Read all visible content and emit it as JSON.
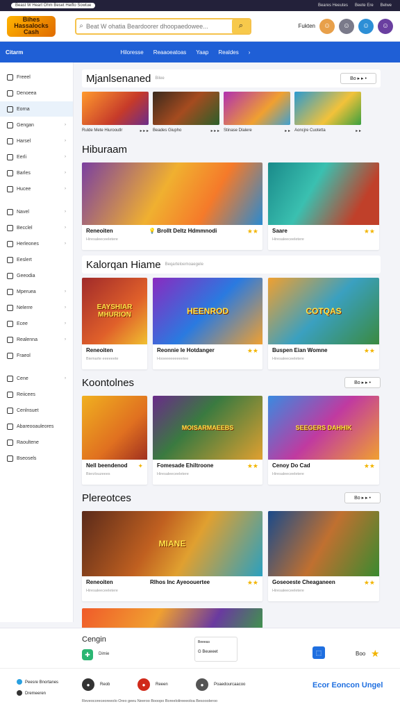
{
  "topbar": {
    "pill": "Beast W Heart Ohm Beset Heiflo Sowtue",
    "links": [
      "Beares Heeutes",
      "Beete Ere",
      "Belwe"
    ]
  },
  "header": {
    "logo": "Bihes Hassalocks Cash",
    "search_placeholder": "Beat W ohatia Beardoorer dhoopaedowee...",
    "right_label": "Fukten"
  },
  "nav": {
    "brand": "Citarm",
    "items": [
      "Hiloresse",
      "Reaaoeatoas",
      "Yaap",
      "Realdes",
      "›"
    ]
  },
  "sidebar": {
    "items": [
      {
        "label": "Freeel",
        "icon": "refresh-icon",
        "chev": ""
      },
      {
        "label": "Denoeea",
        "icon": "globe-icon",
        "chev": ""
      },
      {
        "label": "Eorna",
        "icon": "star-icon",
        "chev": "",
        "active": true
      },
      {
        "label": "Gengan",
        "icon": "controller-icon",
        "chev": "›"
      },
      {
        "label": "Harsel",
        "icon": "gift-icon",
        "chev": "›"
      },
      {
        "label": "Eerli",
        "icon": "trophy-icon",
        "chev": "›"
      },
      {
        "label": "Barles",
        "icon": "puzzle-icon",
        "chev": "›"
      },
      {
        "label": "Hucee",
        "icon": "chart-icon",
        "chev": "›"
      },
      {
        "label": "Navel",
        "icon": "sword-icon",
        "chev": "›"
      },
      {
        "label": "Becclel",
        "icon": "target-icon",
        "chev": "›"
      },
      {
        "label": "Herleones",
        "icon": "crown-icon",
        "chev": "›"
      },
      {
        "label": "Eeslert",
        "icon": "bolt-icon",
        "chev": ""
      },
      {
        "label": "Geeodia",
        "icon": "gem-icon",
        "chev": ""
      },
      {
        "label": "Mperuea",
        "icon": "music-icon",
        "chev": "›"
      },
      {
        "label": "Nelerre",
        "icon": "flag-icon",
        "chev": "›"
      },
      {
        "label": "Ecee",
        "icon": "rocket-icon",
        "chev": "›"
      },
      {
        "label": "Realenna",
        "icon": "car-icon",
        "chev": "›"
      },
      {
        "label": "Fraeol",
        "icon": "heart-icon",
        "chev": ""
      },
      {
        "label": "Cene",
        "icon": "shield-icon",
        "chev": "›"
      },
      {
        "label": "Reiicees",
        "icon": "book-icon",
        "chev": ""
      },
      {
        "label": "Cenlnsuet",
        "icon": "map-icon",
        "chev": ""
      },
      {
        "label": "Abareooauleores",
        "icon": "cup-icon",
        "chev": ""
      },
      {
        "label": "Raoultene",
        "icon": "fire-icon",
        "chev": ""
      },
      {
        "label": "Bseosels",
        "icon": "bell-icon",
        "chev": ""
      }
    ]
  },
  "sections": [
    {
      "title": "Mjanlsenaned",
      "sub": "Bilee",
      "ctl": "Bo ▸ ▸ •",
      "items": [
        {
          "cap": "Rulde Mete Hiurooutlr",
          "ctl": "▸ ▸ ▸"
        },
        {
          "cap": "Beades Giupho",
          "ctl": "▸ ▸ ▸"
        },
        {
          "cap": "Stinase Dlalere",
          "ctl": "▸ ▸"
        },
        {
          "cap": "Aoncjre Cuotetta",
          "ctl": "▸ ▸"
        }
      ]
    },
    {
      "title": "Hiburaam",
      "cards": [
        {
          "title": "Reneoiten",
          "desc": "Hiresaleeceeletere",
          "label": "",
          "right": "💡 Brollt Deltz Hdmmnodi",
          "star": "★★"
        },
        {
          "title": "Saare",
          "desc": "Hiresaleeceeletere",
          "label": "",
          "star": "★★"
        }
      ]
    },
    {
      "title": "Kalorqan Hiame",
      "sub": "Beqarteloemoaegele",
      "cards": [
        {
          "title": "Reneoiten",
          "desc": "Biemarte eeeeeete",
          "label": "EAYSHIAR MHURION",
          "star": ""
        },
        {
          "title": "Reonnie Ie Hotdanger",
          "desc": "Hooeeeeeeeeetee",
          "label": "HEENROD",
          "star": "★★"
        },
        {
          "title": "Buspen Eian Womne",
          "desc": "Hiresaleeceeletere",
          "label": "COTQAS",
          "star": "★★"
        }
      ]
    },
    {
      "title": "Koontolnes",
      "ctl": "Bo ▸ ▸ •",
      "cards": [
        {
          "title": "Nell beendenod",
          "desc": "Bierzlouzeees",
          "label": "",
          "star": "✦"
        },
        {
          "title": "Fomesade Ehiltroone",
          "desc": "Hiresaleeceeletere",
          "label": "MOISARMAEEBS",
          "star": "★★"
        },
        {
          "title": "Cenoy Do Cad",
          "desc": "Hiresaleeceeletere",
          "label": "SEEGERS DAHHIK",
          "star": "★★"
        }
      ]
    },
    {
      "title": "Plereotces",
      "ctl": "Bo ▸ ▸ •",
      "cards": [
        {
          "title": "Reneoiten",
          "desc": "Hiresaleeceeletere",
          "label": "MIANE",
          "right": "Rlhos Inc Ayeoouertee",
          "star": "★★"
        },
        {
          "title": "Goseoeste Cheaganeen",
          "desc": "Hiresaleeceeletere",
          "label": "",
          "star": "★★"
        }
      ]
    }
  ],
  "footer": {
    "contact": "Cengin",
    "badge_label": "Dimie",
    "pop_title": "Beeeas",
    "pop_value": "G  Beueeet",
    "rating": "Boo"
  },
  "bottom": {
    "links": [
      "Peesre Bnortanes",
      "Dremeeren"
    ],
    "social": [
      "Reob",
      "Reeen",
      "Poaedourcaacoo"
    ],
    "brand": "Ecor Eoncon Ungel",
    "copyright": "Reveocoreceoreeolo Oreo geeu Neeroo Booopo Boreelolireeeoloa Besoooleroo"
  }
}
